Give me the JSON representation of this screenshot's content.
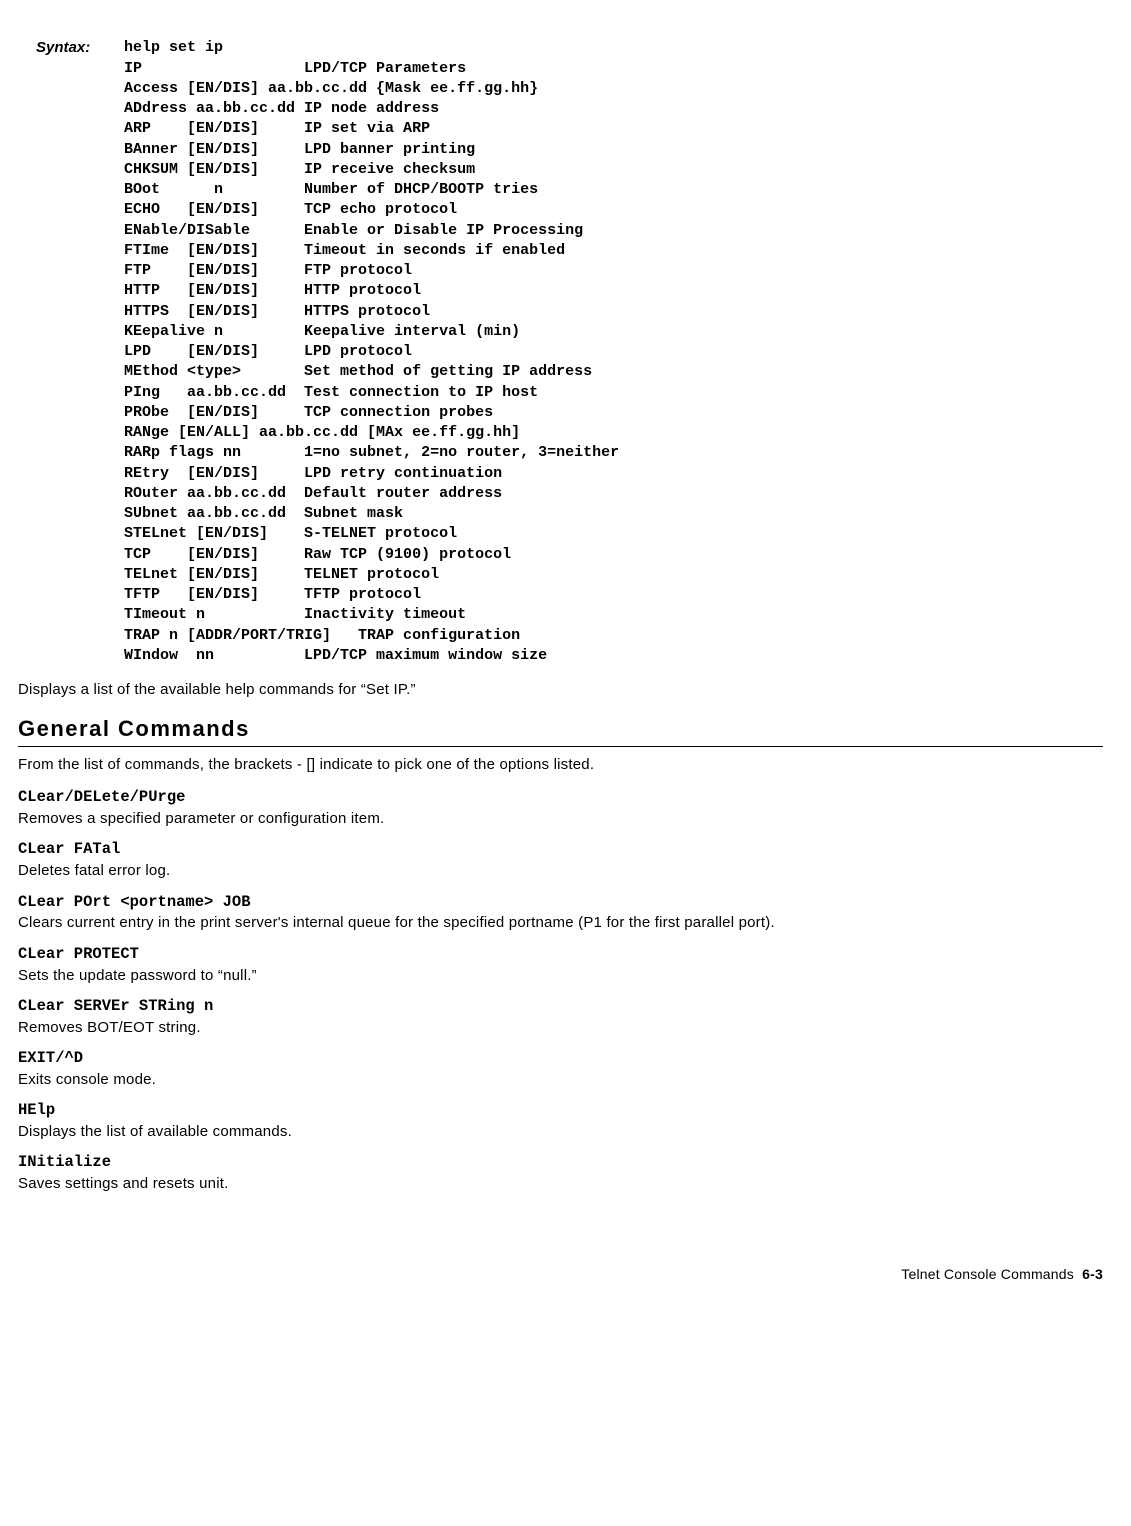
{
  "syntax": {
    "label": "Syntax:",
    "command": "help set ip",
    "lines": [
      "IP                  LPD/TCP Parameters",
      "Access [EN/DIS] aa.bb.cc.dd {Mask ee.ff.gg.hh}",
      "ADdress aa.bb.cc.dd IP node address",
      "ARP    [EN/DIS]     IP set via ARP",
      "BAnner [EN/DIS]     LPD banner printing",
      "CHKSUM [EN/DIS]     IP receive checksum",
      "BOot      n         Number of DHCP/BOOTP tries",
      "ECHO   [EN/DIS]     TCP echo protocol",
      "ENable/DISable      Enable or Disable IP Processing",
      "FTIme  [EN/DIS]     Timeout in seconds if enabled",
      "FTP    [EN/DIS]     FTP protocol",
      "HTTP   [EN/DIS]     HTTP protocol",
      "HTTPS  [EN/DIS]     HTTPS protocol",
      "KEepalive n         Keepalive interval (min)",
      "LPD    [EN/DIS]     LPD protocol",
      "MEthod <type>       Set method of getting IP address",
      "PIng   aa.bb.cc.dd  Test connection to IP host",
      "PRObe  [EN/DIS]     TCP connection probes",
      "RANge [EN/ALL] aa.bb.cc.dd [MAx ee.ff.gg.hh]",
      "RARp flags nn       1=no subnet, 2=no router, 3=neither",
      "REtry  [EN/DIS]     LPD retry continuation",
      "ROuter aa.bb.cc.dd  Default router address",
      "SUbnet aa.bb.cc.dd  Subnet mask",
      "STELnet [EN/DIS]    S-TELNET protocol",
      "TCP    [EN/DIS]     Raw TCP (9100) protocol",
      "TELnet [EN/DIS]     TELNET protocol",
      "TFTP   [EN/DIS]     TFTP protocol",
      "TImeout n           Inactivity timeout",
      "TRAP n [ADDR/PORT/TRIG]   TRAP configuration",
      "WIndow  nn          LPD/TCP maximum window size"
    ]
  },
  "syntax_note": "Displays a list of the available help commands for “Set IP.”",
  "section_heading": "General Commands",
  "section_intro": "From the list of commands, the brackets - [] indicate to pick one of the options listed.",
  "commands": [
    {
      "cmd": "CLear/DELete/PUrge",
      "desc": "Removes a specified parameter or configuration item."
    },
    {
      "cmd": "CLear FATal",
      "desc": "Deletes fatal error log."
    },
    {
      "cmd": "CLear POrt <portname> JOB",
      "desc": "Clears current entry in the print server's internal queue for the specified portname (P1 for the first parallel port)."
    },
    {
      "cmd": "CLear PROTECT",
      "desc": "Sets the update password to “null.”"
    },
    {
      "cmd": "CLear SERVEr STRing n",
      "desc": "Removes BOT/EOT string."
    },
    {
      "cmd": "EXIT/^D",
      "desc": "Exits console mode."
    },
    {
      "cmd": "HElp",
      "desc": "Displays the list of available commands."
    },
    {
      "cmd": "INitialize",
      "desc": "Saves settings and resets unit."
    }
  ],
  "footer": {
    "text": "Telnet Console Commands",
    "page": "6-3"
  }
}
